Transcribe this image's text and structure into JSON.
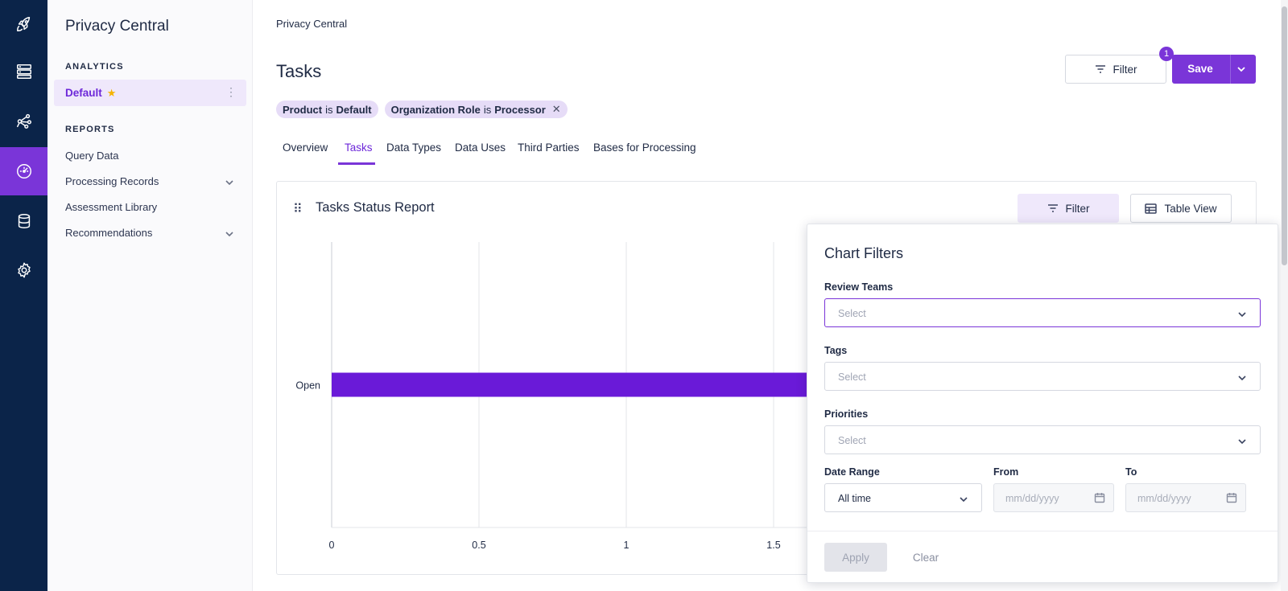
{
  "app": {
    "title": "Privacy Central",
    "accent": "#7a35d8",
    "rail_bg": "#0b2449"
  },
  "rail": {
    "items": [
      {
        "icon": "rocket-icon",
        "active": false
      },
      {
        "icon": "server-icon",
        "active": false
      },
      {
        "icon": "network-icon",
        "active": false
      },
      {
        "icon": "dashboard-gauge-icon",
        "active": true
      },
      {
        "icon": "database-icon",
        "active": false
      },
      {
        "icon": "gear-icon",
        "active": false
      }
    ]
  },
  "sidebar": {
    "title": "Privacy Central",
    "analytics_label": "ANALYTICS",
    "dashboards": [
      {
        "label": "Default",
        "favorite": true,
        "active": true
      }
    ],
    "reports_label": "REPORTS",
    "reports": [
      {
        "label": "Query Data",
        "expandable": false
      },
      {
        "label": "Processing Records",
        "expandable": true
      },
      {
        "label": "Assessment Library",
        "expandable": false
      },
      {
        "label": "Recommendations",
        "expandable": true
      }
    ]
  },
  "header": {
    "breadcrumb": "Privacy Central",
    "title": "Tasks",
    "filter_label": "Filter",
    "filter_count": "1",
    "save_label": "Save"
  },
  "chips": [
    {
      "field": "Product",
      "op": "is",
      "value": "Default",
      "removable": false
    },
    {
      "field": "Organization Role",
      "op": "is",
      "value": "Processor",
      "removable": true
    }
  ],
  "tabs": [
    {
      "label": "Overview",
      "active": false
    },
    {
      "label": "Tasks",
      "active": true
    },
    {
      "label": "Data Types",
      "active": false
    },
    {
      "label": "Data Uses",
      "active": false
    },
    {
      "label": "Third Parties",
      "active": false
    },
    {
      "label": "Bases for Processing",
      "active": false
    }
  ],
  "card": {
    "title": "Tasks Status Report",
    "filter_label": "Filter",
    "table_view_label": "Table View"
  },
  "chart_data": {
    "type": "bar",
    "orientation": "horizontal",
    "categories": [
      "Open"
    ],
    "values": [
      2
    ],
    "xlim": [
      0,
      2
    ],
    "x_ticks": [
      "0",
      "0.5",
      "1",
      "1.5"
    ],
    "color": "#6a1ad8",
    "grid": true
  },
  "chart_filters": {
    "title": "Chart Filters",
    "review_teams": {
      "label": "Review Teams",
      "placeholder": "Select"
    },
    "tags": {
      "label": "Tags",
      "placeholder": "Select"
    },
    "priorities": {
      "label": "Priorities",
      "placeholder": "Select"
    },
    "date_range": {
      "label": "Date Range",
      "value": "All time"
    },
    "from": {
      "label": "From",
      "placeholder": "mm/dd/yyyy"
    },
    "to": {
      "label": "To",
      "placeholder": "mm/dd/yyyy"
    },
    "apply_label": "Apply",
    "clear_label": "Clear"
  }
}
